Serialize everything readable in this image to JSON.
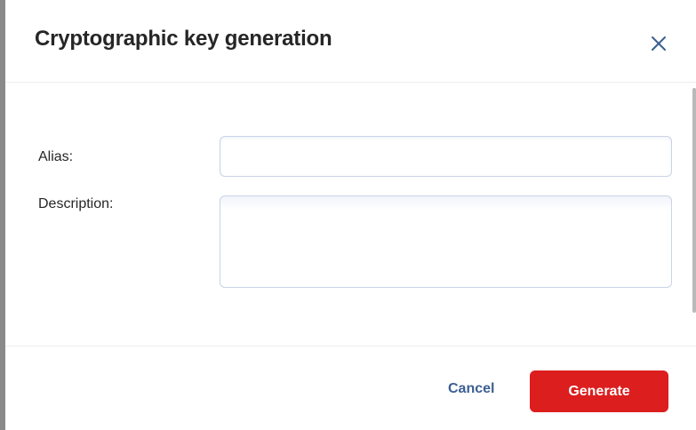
{
  "dialog": {
    "title": "Cryptographic key generation",
    "close_icon": "close-icon"
  },
  "form": {
    "alias_label": "Alias:",
    "alias_value": "",
    "description_label": "Description:",
    "description_value": ""
  },
  "footer": {
    "cancel_label": "Cancel",
    "generate_label": "Generate"
  },
  "colors": {
    "accent": "#dc1e1e",
    "link": "#3b5f92",
    "input_border": "#c9d3e6"
  }
}
